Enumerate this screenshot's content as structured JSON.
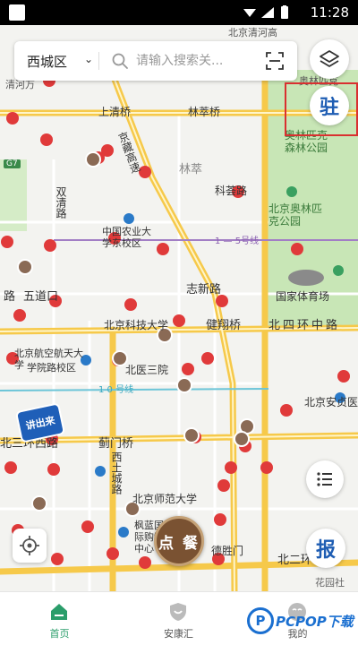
{
  "status_bar": {
    "time": "11:28"
  },
  "search": {
    "district": "西城区",
    "placeholder": "请输入搜索关..."
  },
  "map_labels": {
    "tsinghua": "北京清河高",
    "qinghe": "清河万",
    "olympic_south": "奥林匹克",
    "shangqing_bridge": "上清桥",
    "linsui_bridge": "林萃桥",
    "jingzang": "京藏高速",
    "olympic_forest": "奥林匹克森林公园",
    "lincui": "林萃",
    "kechuang_road": "科荟路",
    "olympic_park": "北京奥林匹克公园",
    "shuangqing_road": "双清路",
    "agri_univ": "中国农业大学东校区",
    "line15": "1 — 5号线",
    "wudaokou": "五道口",
    "zhixin_road": "志新路",
    "stadium": "国家体育场",
    "road_lu": "路",
    "ustb": "北京科技大学",
    "jianxiang_bridge": "健翔桥",
    "north4_ring": "北四环中路",
    "buaa": "北京航空航天大学",
    "xueyuan_road": "学院路校区",
    "beiyi_3": "北医三院",
    "line10": "1 0 号线",
    "north3_ring": "北三环西路",
    "jimen_bridge": "蓟门桥",
    "xitucheng_road": "西土城路",
    "bnu": "北京师范大学",
    "fenglan": "枫蓝国际购物中心",
    "deshengmen": "德胜门",
    "anzhen": "北京安贞医",
    "north2_ring": "北二环",
    "huayuan": "花园社",
    "g7": "G7"
  },
  "buttons": {
    "zhu": "驻",
    "report": "报",
    "order": "点 餐",
    "chuanjiang": "讲出来"
  },
  "tabs": [
    {
      "label": "首页",
      "active": true
    },
    {
      "label": "安康汇",
      "active": false
    },
    {
      "label": "我的",
      "active": false
    }
  ],
  "watermark": {
    "logo": "P",
    "text": "PCPOP下载"
  },
  "colors": {
    "accent_green": "#2a9d6a",
    "brand_blue": "#1e5db3",
    "marker_red": "#e03a3a",
    "road_yellow": "#f6c94a",
    "park_green": "#c8e6b6"
  }
}
